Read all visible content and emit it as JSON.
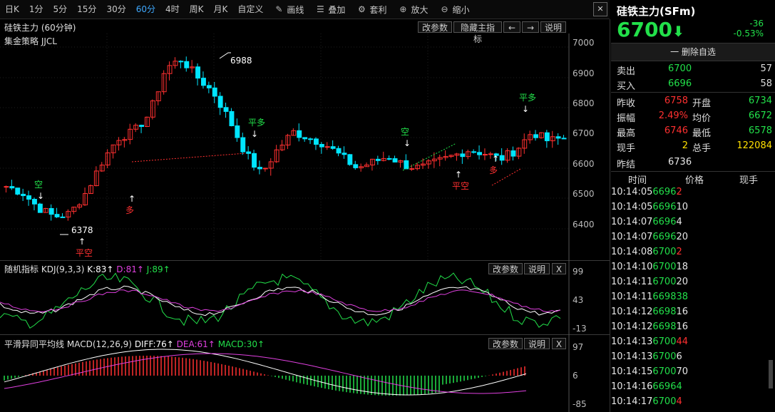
{
  "toolbar": {
    "periods": [
      "日K",
      "1分",
      "5分",
      "15分",
      "30分",
      "60分",
      "4时",
      "周K",
      "月K",
      "自定义"
    ],
    "active_period": "60分",
    "tools": [
      {
        "label": "画线",
        "icon": "pencil-icon"
      },
      {
        "label": "叠加",
        "icon": "stack-icon"
      },
      {
        "label": "套利",
        "icon": "arbitrage-icon"
      },
      {
        "label": "放大",
        "icon": "zoom-in-icon"
      },
      {
        "label": "缩小",
        "icon": "zoom-out-icon"
      }
    ],
    "close_label": "✕"
  },
  "main_panel": {
    "title": "硅铁主力 (60分钟)",
    "strategy": "集金策略 JJCL",
    "buttons": {
      "params": "改参数",
      "hide": "隐藏主指标",
      "left": "←",
      "right": "→",
      "help": "说明"
    },
    "y_ticks": [
      "7000",
      "6900",
      "6800",
      "6700",
      "6600",
      "6500",
      "6400"
    ],
    "annotations": {
      "high": "6988",
      "low": "6378"
    },
    "signals": [
      {
        "label": "空",
        "color": "#22e04a"
      },
      {
        "label": "平空",
        "color": "#ff3030"
      },
      {
        "label": "多",
        "color": "#ff3030"
      },
      {
        "label": "平多",
        "color": "#22e04a"
      },
      {
        "label": "空",
        "color": "#22e04a"
      },
      {
        "label": "平空",
        "color": "#ff3030"
      },
      {
        "label": "多",
        "color": "#ff3030"
      },
      {
        "label": "平多",
        "color": "#22e04a"
      }
    ]
  },
  "kdj_panel": {
    "name": "随机指标",
    "params": "KDJ(9,3,3)",
    "k": "K:83↑",
    "d": "D:81↑",
    "j": "J:89↑",
    "buttons": {
      "params": "改参数",
      "help": "说明",
      "close": "X"
    },
    "y_ticks": [
      "99",
      "43",
      "-13"
    ]
  },
  "macd_panel": {
    "name": "平滑异同平均线",
    "params": "MACD(12,26,9)",
    "diff": "DIFF:76↑",
    "dea": "DEA:61↑",
    "macd": "MACD:30↑",
    "buttons": {
      "params": "改参数",
      "help": "说明",
      "close": "X"
    },
    "y_ticks": [
      "97",
      "6",
      "-85"
    ]
  },
  "quote": {
    "title": "硅铁主力(SFm)",
    "price": "6700",
    "change": "-36",
    "change_pct": "-0.53%",
    "watchlist_btn": "一 删除自选",
    "sell": {
      "label": "卖出",
      "price": "6700",
      "vol": "57"
    },
    "buy": {
      "label": "买入",
      "price": "6696",
      "vol": "58"
    },
    "stats": [
      {
        "l1": "昨收",
        "v1": "6758",
        "c1": "red",
        "l2": "开盘",
        "v2": "6734",
        "c2": "green"
      },
      {
        "l1": "振幅",
        "v1": "2.49%",
        "c1": "red",
        "l2": "均价",
        "v2": "6672",
        "c2": "green"
      },
      {
        "l1": "最高",
        "v1": "6746",
        "c1": "red",
        "l2": "最低",
        "v2": "6578",
        "c2": "green"
      },
      {
        "l1": "现手",
        "v1": "2",
        "c1": "yellow",
        "l2": "总手",
        "v2": "122084",
        "c2": "yellow"
      }
    ],
    "settle": {
      "label": "昨结",
      "value": "6736"
    },
    "tick_headers": [
      "时间",
      "价格",
      "现手"
    ],
    "ticks": [
      {
        "t": "10:14:05",
        "p": "6696",
        "v": "2",
        "vc": "red"
      },
      {
        "t": "10:14:05",
        "p": "6696",
        "v": "10",
        "vc": "white"
      },
      {
        "t": "10:14:07",
        "p": "6696",
        "v": "4",
        "vc": "white"
      },
      {
        "t": "10:14:07",
        "p": "6696",
        "v": "20",
        "vc": "white"
      },
      {
        "t": "10:14:08",
        "p": "6700",
        "v": "2",
        "vc": "red"
      },
      {
        "t": "10:14:10",
        "p": "6700",
        "v": "18",
        "vc": "white"
      },
      {
        "t": "10:14:11",
        "p": "6700",
        "v": "20",
        "vc": "white"
      },
      {
        "t": "10:14:11",
        "p": "6698",
        "v": "38",
        "vc": "green"
      },
      {
        "t": "10:14:12",
        "p": "6698",
        "v": "16",
        "vc": "white"
      },
      {
        "t": "10:14:12",
        "p": "6698",
        "v": "16",
        "vc": "white"
      },
      {
        "t": "10:14:13",
        "p": "6700",
        "v": "44",
        "vc": "red"
      },
      {
        "t": "10:14:13",
        "p": "6700",
        "v": "6",
        "vc": "white"
      },
      {
        "t": "10:14:15",
        "p": "6700",
        "v": "70",
        "vc": "white"
      },
      {
        "t": "10:14:16",
        "p": "6696",
        "v": "4",
        "vc": "green"
      },
      {
        "t": "10:14:17",
        "p": "6700",
        "v": "4",
        "vc": "red"
      }
    ]
  },
  "colors": {
    "up": "#ff3030",
    "down": "#00e5ff",
    "green": "#22e04a",
    "magenta": "#e040e0",
    "white": "#ffffff"
  }
}
